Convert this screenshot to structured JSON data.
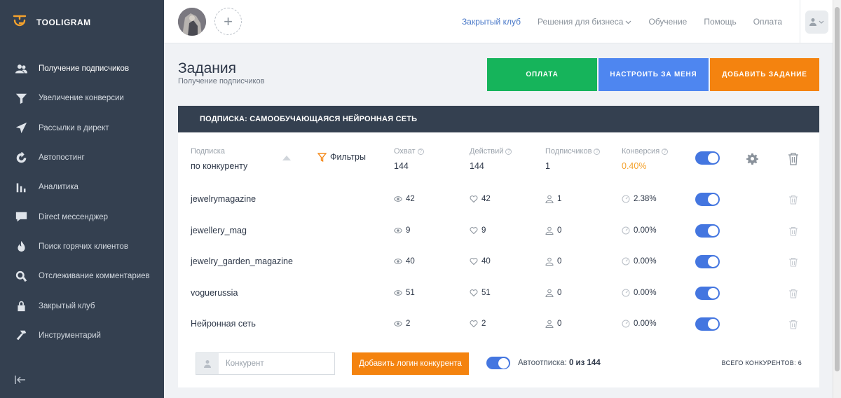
{
  "brand": {
    "name": "TOOLIGRAM"
  },
  "sidebar": {
    "items": [
      {
        "label": "Получение подписчиков",
        "icon": "users-icon",
        "active": true
      },
      {
        "label": "Увеличение конверсии",
        "icon": "funnel-icon"
      },
      {
        "label": "Рассылки в директ",
        "icon": "send-icon"
      },
      {
        "label": "Автопостинг",
        "icon": "refresh-icon"
      },
      {
        "label": "Аналитика",
        "icon": "bar-chart-icon"
      },
      {
        "label": "Direct мессенджер",
        "icon": "message-icon"
      },
      {
        "label": "Поиск горячих клиентов",
        "icon": "flame-icon"
      },
      {
        "label": "Отслеживание комментариев",
        "icon": "search-icon"
      },
      {
        "label": "Закрытый клуб",
        "icon": "lock-icon"
      },
      {
        "label": "Инструментарий",
        "icon": "hammer-icon"
      }
    ]
  },
  "topnav": {
    "club": "Закрытый клуб",
    "business": "Решения для бизнеса",
    "learning": "Обучение",
    "help": "Помощь",
    "payment": "Оплата"
  },
  "page": {
    "title": "Задания",
    "subtitle": "Получение подписчиков"
  },
  "actions": {
    "pay": "ОПЛАТА",
    "setup": "НАСТРОИТЬ ЗА МЕНЯ",
    "add": "ДОБАВИТЬ ЗАДАНИЕ"
  },
  "task": {
    "title": "ПОДПИСКА: САМООБУЧАЮЩАЯСЯ НЕЙРОННАЯ СЕТЬ",
    "type_label": "Подписка",
    "type_value": "по конкуренту",
    "filters": "Фильтры",
    "reach_label": "Охват",
    "reach": "144",
    "actions_label": "Действий",
    "actions": "144",
    "subs_label": "Подписчиков",
    "subs": "1",
    "conv_label": "Конверсия",
    "conv": "0.40%"
  },
  "rows": [
    {
      "name": "jewelrymagazine",
      "reach": "42",
      "actions": "42",
      "subs": "1",
      "conv": "2.38%"
    },
    {
      "name": "jewellery_mag",
      "reach": "9",
      "actions": "9",
      "subs": "0",
      "conv": "0.00%"
    },
    {
      "name": "jewelry_garden_magazine",
      "reach": "40",
      "actions": "40",
      "subs": "0",
      "conv": "0.00%"
    },
    {
      "name": "voguerussia",
      "reach": "51",
      "actions": "51",
      "subs": "0",
      "conv": "0.00%"
    },
    {
      "name": "Нейронная сеть",
      "reach": "2",
      "actions": "2",
      "subs": "0",
      "conv": "0.00%"
    }
  ],
  "footer": {
    "placeholder": "Конкурент",
    "add_button": "Добавить логин конкурента",
    "auto_label": "Автоотписка:",
    "auto_value": "0 из 144",
    "total": "ВСЕГО КОНКУРЕНТОВ: 6"
  },
  "colors": {
    "sidebar": "#344050",
    "green": "#16b45b",
    "blue": "#4e86f0",
    "orange": "#f4830f",
    "toggle": "#4476e0"
  }
}
